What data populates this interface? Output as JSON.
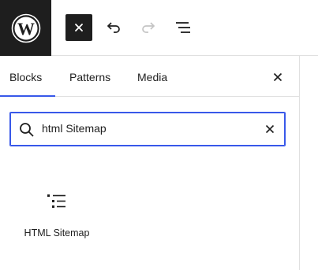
{
  "toolbar": {
    "logo_icon": "wordpress-logo-icon",
    "close_icon": "close-icon",
    "undo_icon": "undo-icon",
    "redo_icon": "redo-icon",
    "document_overview_icon": "list-view-icon",
    "accent_color": "#1e1e1e"
  },
  "inserter": {
    "tabs": [
      {
        "label": "Blocks"
      },
      {
        "label": "Patterns"
      },
      {
        "label": "Media"
      }
    ],
    "active_tab_color": "#3858e9",
    "search": {
      "value": "html Sitemap"
    },
    "results": [
      {
        "label": "HTML Sitemap",
        "icon": "sitemap-list-icon"
      }
    ]
  }
}
